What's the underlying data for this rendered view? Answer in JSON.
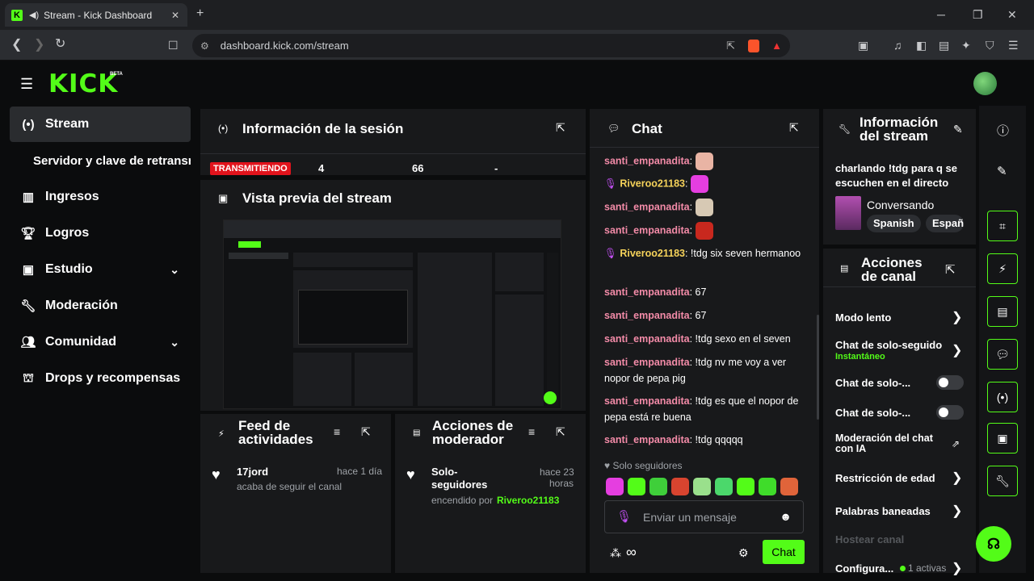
{
  "browser": {
    "tab_title": "Stream - Kick Dashboard",
    "url": "dashboard.kick.com/stream",
    "new_tab": "+",
    "minimize": "─",
    "restore": "❐",
    "close": "✕"
  },
  "header": {
    "logo": "KICK",
    "beta": "BETA"
  },
  "sidebar": {
    "items": [
      {
        "label": "Stream",
        "icon": "broadcast-icon"
      },
      {
        "label": "Servidor y clave de retransn",
        "icon": ""
      },
      {
        "label": "Ingresos",
        "icon": "chart-icon"
      },
      {
        "label": "Logros",
        "icon": "trophy-icon"
      },
      {
        "label": "Estudio",
        "icon": "studio-icon"
      },
      {
        "label": "Moderación",
        "icon": "wrench-icon"
      },
      {
        "label": "Comunidad",
        "icon": "community-icon"
      },
      {
        "label": "Drops y recompensas",
        "icon": "drops-icon"
      }
    ]
  },
  "session": {
    "title": "Información de la sesión",
    "status": "TRANSMITIENDO",
    "stat1": "4",
    "stat2": "66",
    "stat3": "-"
  },
  "preview": {
    "title": "Vista previa del stream"
  },
  "feed": {
    "title_line1": "Feed de",
    "title_line2": "actividades",
    "item_user": "17jord",
    "item_time": "hace 1 día",
    "item_text": "acaba de seguir el canal"
  },
  "modactions": {
    "title_line1": "Acciones de",
    "title_line2": "moderador",
    "item_line1": "Solo-",
    "item_line2": "seguidores",
    "item_time1": "hace 23",
    "item_time2": "horas",
    "item_text": "encendido por",
    "item_user": "Riveroo21183"
  },
  "chat": {
    "title": "Chat",
    "messages": [
      {
        "user": "santi_empanadita",
        "text": ""
      },
      {
        "user": "Riveroo21183",
        "text": ""
      },
      {
        "user": "santi_empanadita",
        "text": ""
      },
      {
        "user": "santi_empanadita",
        "text": ""
      },
      {
        "user": "Riveroo21183",
        "text": "!tdg six seven hermanoo"
      },
      {
        "user": "santi_empanadita",
        "text": "67"
      },
      {
        "user": "santi_empanadita",
        "text": "67"
      },
      {
        "user": "santi_empanadita",
        "text": "!tdg sexo en el seven"
      },
      {
        "user": "santi_empanadita",
        "text": "!tdg nv me voy a ver nopor de pepa pig"
      },
      {
        "user": "santi_empanadita",
        "text": "!tdg es que el nopor de pepa está re buena"
      },
      {
        "user": "santi_empanadita",
        "text": "!tdg qqqqq"
      }
    ],
    "mode_label": "Solo seguidores",
    "input_placeholder": "Enviar un mensaje",
    "send_label": "Chat"
  },
  "stream_info": {
    "title_line1": "Información",
    "title_line2": "del stream",
    "stream_title": "charlando !tdg para q se escuchen en el directo",
    "category": "Conversando",
    "tag1": "Spanish",
    "tag2": "Españ"
  },
  "channel_actions": {
    "title_line1": "Acciones",
    "title_line2": "de canal",
    "slow_mode": "Modo lento",
    "follower_only": "Chat de solo-seguido",
    "follower_only_sub": "Instantáneo",
    "sub_only": "Chat de solo-...",
    "emote_only": "Chat de solo-...",
    "ai_mod_line1": "Moderación del chat",
    "ai_mod_line2": "con IA",
    "age_restriction": "Restricción de edad",
    "banned_words": "Palabras baneadas",
    "host_channel": "Hostear canal",
    "config": "Configura...",
    "config_active": "1 activas"
  },
  "colors": {
    "brand": "#53fc18",
    "panel": "#18191b",
    "bg": "#0b0c0d",
    "user_pink": "#f38ba8",
    "user_gold": "#f5d25a",
    "live_red": "#e1131c"
  }
}
